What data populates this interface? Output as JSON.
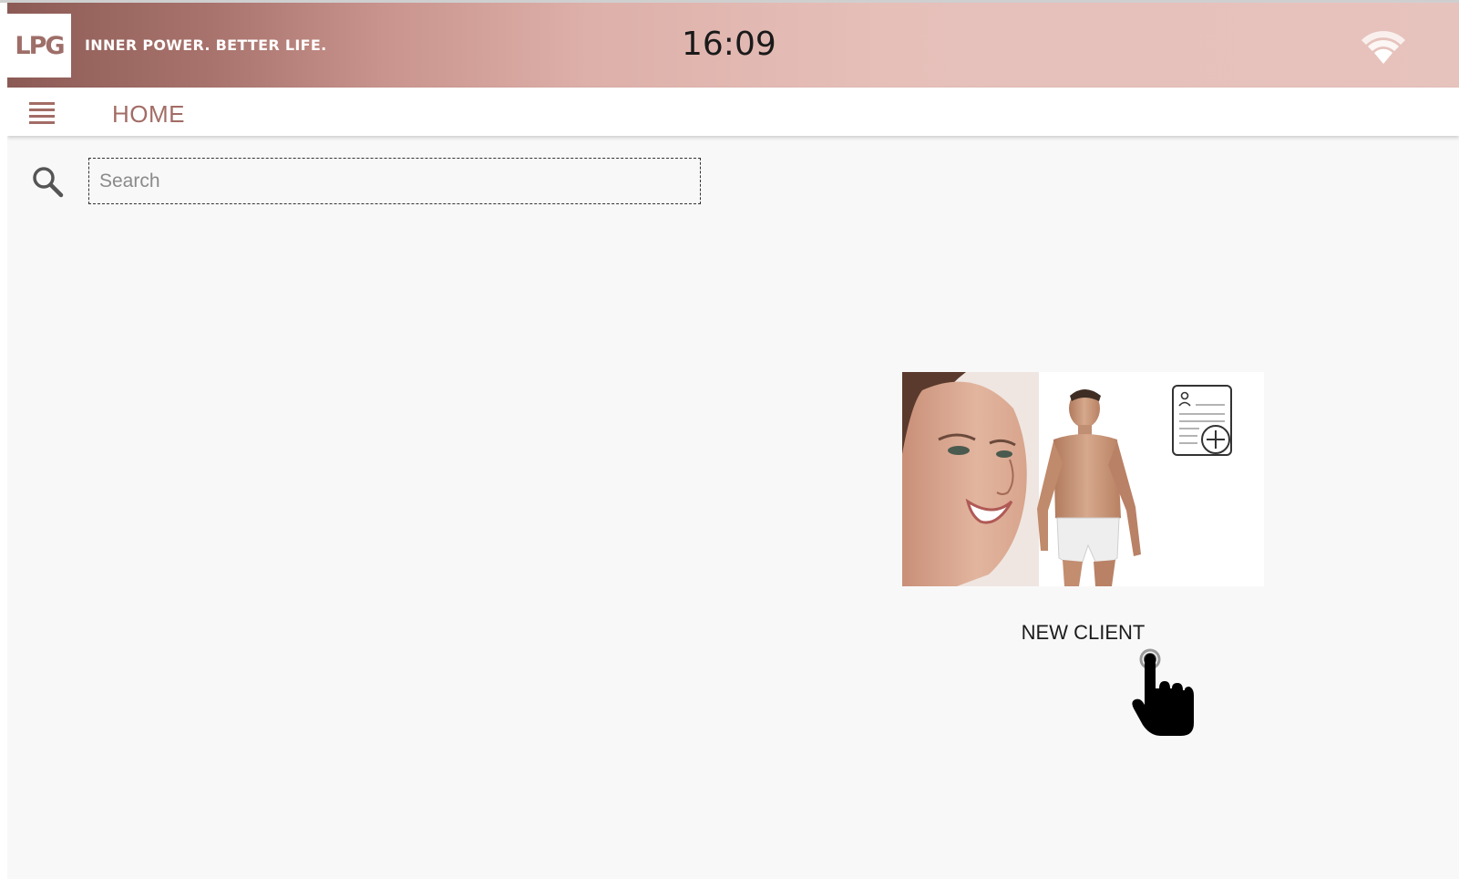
{
  "status_bar": {
    "logo_text": "LPG",
    "tagline": "INNER POWER. BETTER LIFE.",
    "time": "16:09",
    "wifi_icon": "wifi-icon"
  },
  "app_bar": {
    "menu_icon": "hamburger-menu-icon",
    "title": "HOME"
  },
  "search": {
    "icon": "search-icon",
    "placeholder": "Search",
    "value": ""
  },
  "tiles": [
    {
      "label": "NEW CLIENT",
      "image": "woman-face-and-man-body-photo",
      "icon": "client-record-add-icon"
    }
  ],
  "overlay": {
    "pointer_icon": "tap-hand-cursor-icon"
  },
  "colors": {
    "brand": "#a26c65",
    "status_bar_gradient_start": "#8c5a55",
    "status_bar_gradient_end": "#e7c3bd",
    "background": "#f8f8f8"
  }
}
